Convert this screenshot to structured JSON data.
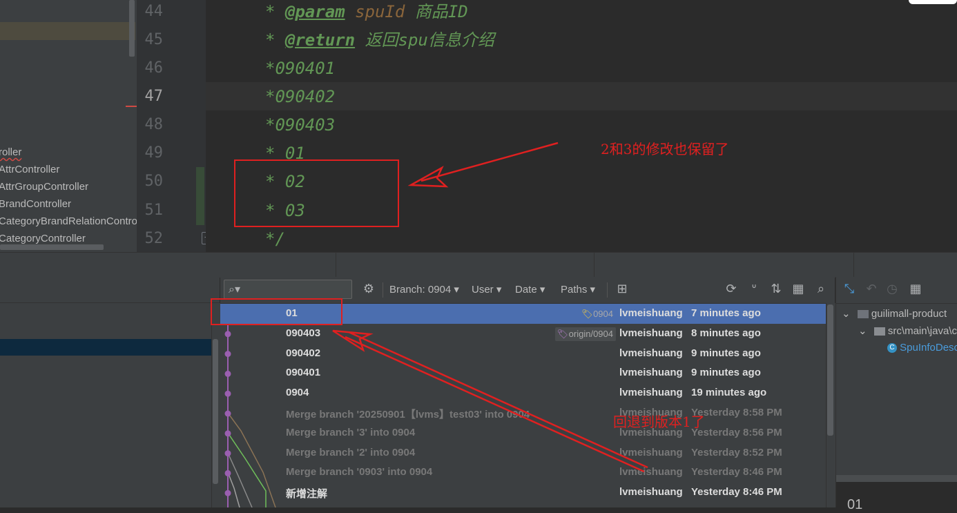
{
  "project_tree": {
    "items": [
      {
        "label": "roller",
        "error": true
      },
      {
        "label": "AttrController"
      },
      {
        "label": "AttrGroupController"
      },
      {
        "label": "BrandController"
      },
      {
        "label": "CategoryBrandRelationControll"
      },
      {
        "label": "CategoryController"
      }
    ]
  },
  "editor": {
    "current_line": 47,
    "lines": [
      {
        "no": "44",
        "parts": [
          {
            "t": "* ",
            "c": "plain"
          },
          {
            "t": "@param",
            "c": "tag"
          },
          {
            "t": " ",
            "c": "plain"
          },
          {
            "t": "spuId",
            "c": "param"
          },
          {
            "t": " 商品ID",
            "c": "plain"
          }
        ]
      },
      {
        "no": "45",
        "parts": [
          {
            "t": "* ",
            "c": "plain"
          },
          {
            "t": "@return",
            "c": "tag"
          },
          {
            "t": " 返回spu信息介绍",
            "c": "plain"
          }
        ]
      },
      {
        "no": "46",
        "parts": [
          {
            "t": "*090401",
            "c": "plain"
          }
        ]
      },
      {
        "no": "47",
        "parts": [
          {
            "t": "*090402",
            "c": "plain"
          }
        ]
      },
      {
        "no": "48",
        "parts": [
          {
            "t": "*090403",
            "c": "plain"
          }
        ]
      },
      {
        "no": "49",
        "parts": [
          {
            "t": "* 01",
            "c": "plain"
          }
        ]
      },
      {
        "no": "50",
        "parts": [
          {
            "t": "* 02",
            "c": "plain"
          }
        ]
      },
      {
        "no": "51",
        "parts": [
          {
            "t": "* 03",
            "c": "plain"
          }
        ]
      },
      {
        "no": "52",
        "parts": [
          {
            "t": "*/",
            "c": "plain"
          }
        ]
      }
    ]
  },
  "annotations": {
    "editor_note": "2和3的修改也保留了",
    "log_note": "回退到版本1了"
  },
  "git_log": {
    "toolbar": {
      "branch": "Branch: 0904",
      "user": "User",
      "date": "Date",
      "paths": "Paths"
    },
    "commits": [
      {
        "subject": "01",
        "label": "0904",
        "label_kind": "tag-yellow",
        "author": "lvmeishuang",
        "date": "7 minutes ago",
        "selected": true,
        "dim": false
      },
      {
        "subject": "090403",
        "label": "origin/0904",
        "label_kind": "tag-purple",
        "author": "lvmeishuang",
        "date": "8 minutes ago",
        "selected": false,
        "dim": false
      },
      {
        "subject": "090402",
        "label": "",
        "author": "lvmeishuang",
        "date": "9 minutes ago",
        "selected": false,
        "dim": false
      },
      {
        "subject": "090401",
        "label": "",
        "author": "lvmeishuang",
        "date": "9 minutes ago",
        "selected": false,
        "dim": false
      },
      {
        "subject": "0904",
        "label": "",
        "author": "lvmeishuang",
        "date": "19 minutes ago",
        "selected": false,
        "dim": false
      },
      {
        "subject": "Merge branch '20250901【lvms】test03' into 0904",
        "label": "",
        "author": "lvmeishuang",
        "date": "Yesterday 8:58 PM",
        "selected": false,
        "dim": true
      },
      {
        "subject": "Merge branch '3' into 0904",
        "label": "",
        "author": "lvmeishuang",
        "date": "Yesterday 8:56 PM",
        "selected": false,
        "dim": true
      },
      {
        "subject": "Merge branch '2' into 0904",
        "label": "",
        "author": "lvmeishuang",
        "date": "Yesterday 8:52 PM",
        "selected": false,
        "dim": true
      },
      {
        "subject": "Merge branch '0903' into 0904",
        "label": "",
        "author": "lvmeishuang",
        "date": "Yesterday 8:46 PM",
        "selected": false,
        "dim": true
      },
      {
        "subject": "新增注解",
        "label": "",
        "author": "lvmeishuang",
        "date": "Yesterday 8:46 PM",
        "selected": false,
        "dim": false
      }
    ]
  },
  "changes_pane": {
    "root": "guilimall-product",
    "folder": "src\\main\\java\\c",
    "file": "SpuInfoDesc",
    "bottom_text": "01"
  },
  "colors": {
    "comment_green": "#629755",
    "selection_blue": "#4b6eaf",
    "annotation_red": "#e02020",
    "graph_purple": "#9a5fb0",
    "graph_green": "#6fbf5a",
    "graph_brown": "#8b7355"
  }
}
